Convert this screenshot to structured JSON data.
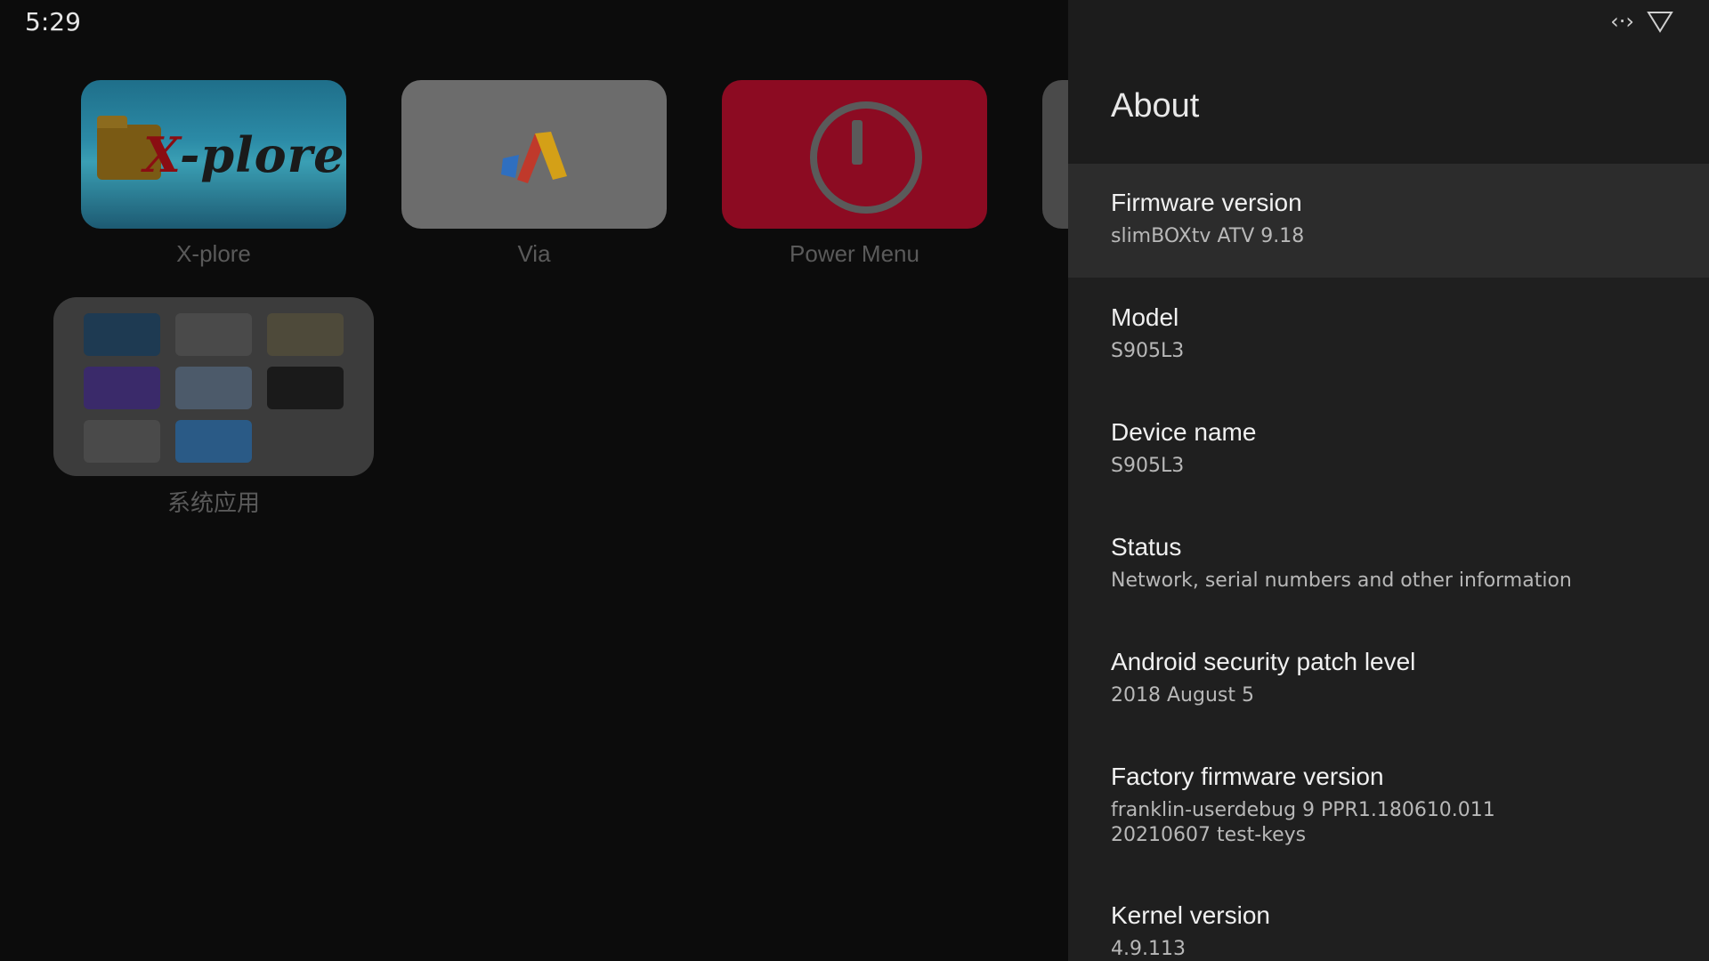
{
  "status_bar": {
    "time": "5:29",
    "icons": [
      "network-arrows-icon",
      "wifi-icon"
    ]
  },
  "launcher": {
    "apps": [
      {
        "label": "X-plore",
        "icon": "xplore-icon",
        "logo_text_a": "X",
        "logo_text_b": "-plore"
      },
      {
        "label": "Via",
        "icon": "via-icon"
      },
      {
        "label": "Power Menu",
        "icon": "power-icon"
      }
    ],
    "folder": {
      "label": "系统应用",
      "apps": [
        "settings-icon",
        "google-play-store-icon",
        "file-browser-icon",
        "equalizer-icon",
        "media-icon",
        "apps-grid-icon",
        "leankey-keyboard-icon",
        "camera-icon"
      ]
    }
  },
  "about_panel": {
    "title": "About",
    "items": [
      {
        "title": "Firmware version",
        "subtitle": "slimBOXtv ATV 9.18"
      },
      {
        "title": "Model",
        "subtitle": "S905L3"
      },
      {
        "title": "Device name",
        "subtitle": "S905L3"
      },
      {
        "title": "Status",
        "subtitle": "Network, serial numbers and other information"
      },
      {
        "title": "Android security patch level",
        "subtitle": "2018 August 5"
      },
      {
        "title": "Factory firmware version",
        "subtitle": "franklin-userdebug 9 PPR1.180610.011 20210607 test-keys"
      },
      {
        "title": "Kernel version",
        "subtitle": "4.9.113"
      }
    ]
  }
}
